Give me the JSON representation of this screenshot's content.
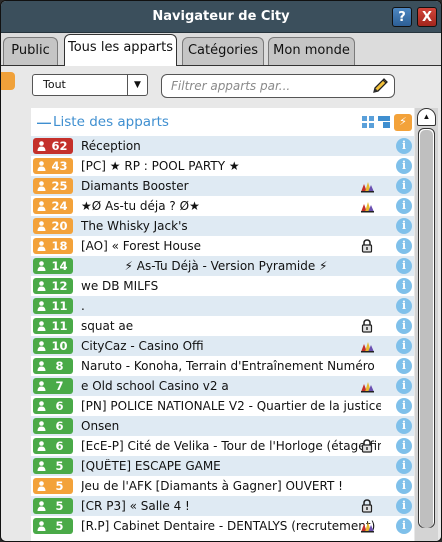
{
  "window": {
    "title": "Navigateur de City",
    "help_label": "?",
    "close_label": "X"
  },
  "tabs": [
    {
      "label": "Public",
      "active": false
    },
    {
      "label": "Tous les apparts",
      "active": true
    },
    {
      "label": "Catégories",
      "active": false
    },
    {
      "label": "Mon monde",
      "active": false
    }
  ],
  "filter": {
    "dropdown_value": "Tout",
    "search_placeholder": "Filtrer apparts par..."
  },
  "list": {
    "title": "Liste des apparts",
    "collapse_glyph": "—",
    "rooms": [
      {
        "users": "62",
        "level": "red",
        "name": "Réception",
        "icon": ""
      },
      {
        "users": "43",
        "level": "orange",
        "name": "[PC] ★ RP : POOL PARTY ★",
        "icon": ""
      },
      {
        "users": "25",
        "level": "orange",
        "name": "Diamants Booster",
        "icon": "group-icon"
      },
      {
        "users": "24",
        "level": "orange",
        "name": "★Ø As-tu déja ? Ø★",
        "icon": "group-icon"
      },
      {
        "users": "20",
        "level": "orange",
        "name": "The Whisky Jack's",
        "icon": ""
      },
      {
        "users": "18",
        "level": "orange",
        "name": "[AO] « Forest House",
        "icon": "lock-icon"
      },
      {
        "users": "14",
        "level": "green",
        "name": "⚡ As-Tu Déjà - Version Pyramide ⚡",
        "icon": "",
        "centered": true
      },
      {
        "users": "12",
        "level": "green",
        "name": "we DB MILFS",
        "icon": ""
      },
      {
        "users": "11",
        "level": "green",
        "name": ".",
        "icon": ""
      },
      {
        "users": "11",
        "level": "green",
        "name": "squat ae",
        "icon": "lock-icon"
      },
      {
        "users": "10",
        "level": "green",
        "name": "CityCaz - Casino Offi",
        "icon": "group-icon"
      },
      {
        "users": "8",
        "level": "green",
        "name": "Naruto - Konoha, Terrain d'Entraînement Numéro",
        "icon": ""
      },
      {
        "users": "7",
        "level": "green",
        "name": "e Old school Casino v2 a",
        "icon": "group-icon"
      },
      {
        "users": "6",
        "level": "green",
        "name": "[PN] POLICE NATIONALE V2 - Quartier de la justice",
        "icon": ""
      },
      {
        "users": "6",
        "level": "green",
        "name": "Onsen",
        "icon": ""
      },
      {
        "users": "6",
        "level": "green",
        "name": "[EcE-P] Cité de Velika - Tour de l'Horloge (étage fin",
        "icon": "lock-icon"
      },
      {
        "users": "5",
        "level": "green",
        "name": "[QUÊTE] ESCAPE GAME",
        "icon": ""
      },
      {
        "users": "5",
        "level": "orange",
        "name": "Jeu de l'AFK [Diamants à Gagner] OUVERT !",
        "icon": ""
      },
      {
        "users": "5",
        "level": "green",
        "name": "[CR P3] « Salle 4 !",
        "icon": "lock-icon"
      },
      {
        "users": "5",
        "level": "green",
        "name": "[R.P] Cabinet Dentaire -  DENTALYS (recrutement)",
        "icon": "group-icon"
      }
    ]
  },
  "scrollbar": {
    "position": 0.0
  },
  "colors": {
    "titlebar": "#3b4f5c",
    "accent_blue": "#3f8fd0",
    "badge_red": "#c4302b",
    "badge_orange": "#f3a23a",
    "badge_green": "#4aaa48",
    "row_alt": "#dfeaf3"
  }
}
